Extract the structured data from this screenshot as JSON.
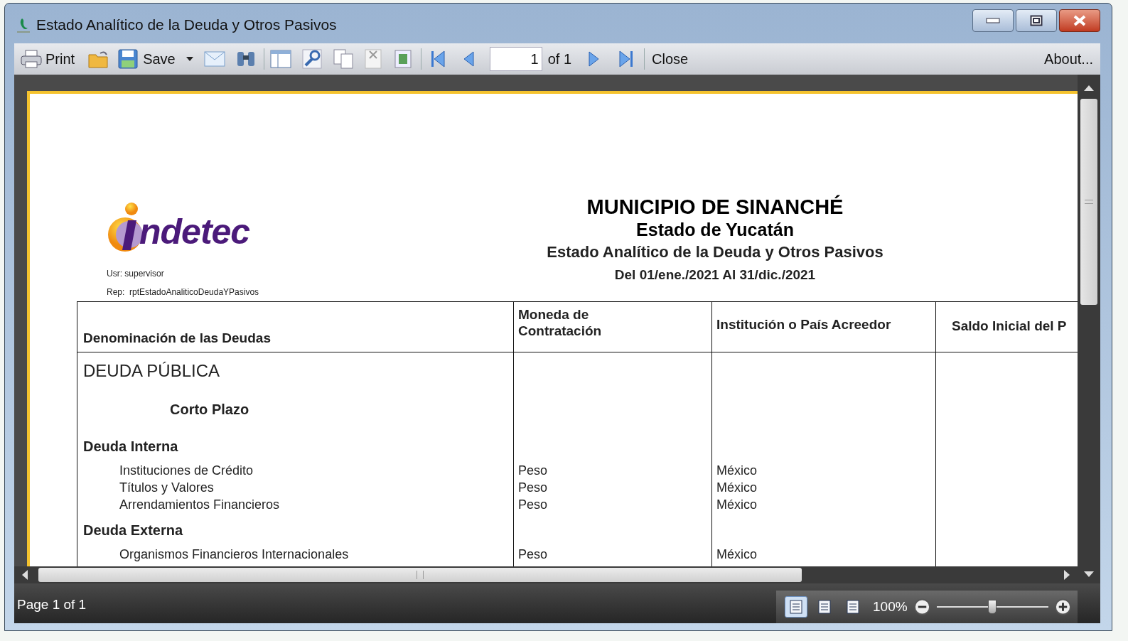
{
  "window": {
    "title": "Estado Analítico de la Deuda y Otros Pasivos"
  },
  "toolbar": {
    "print_label": "Print",
    "save_label": "Save",
    "page_field": {
      "value": "1"
    },
    "page_total": "of 1",
    "close_label": "Close",
    "about_label": "About..."
  },
  "report": {
    "logo_text": "ndetec",
    "user": "Usr: supervisor",
    "rep": "Rep:  rptEstadoAnaliticoDeudaYPasivos",
    "titles": [
      "MUNICIPIO DE SINANCHÉ",
      "Estado de Yucatán",
      "Estado Analítico de la Deuda y Otros Pasivos",
      "Del 01/ene./2021 Al 31/dic./2021"
    ],
    "columns": [
      "Denominación de las Deudas",
      "Moneda de Contratación",
      "Institución o País Acreedor",
      "Saldo Inicial del P"
    ],
    "rows": [
      {
        "kind": "section",
        "name": "DEUDA PÚBLICA"
      },
      {
        "kind": "term",
        "name": "Corto Plazo"
      },
      {
        "kind": "group",
        "name": "Deuda Interna"
      },
      {
        "kind": "item",
        "name": "Instituciones de Crédito",
        "currency": "Peso",
        "creditor": "México"
      },
      {
        "kind": "item",
        "name": "Títulos y Valores",
        "currency": "Peso",
        "creditor": "México"
      },
      {
        "kind": "item",
        "name": "Arrendamientos Financieros",
        "currency": "Peso",
        "creditor": "México"
      },
      {
        "kind": "group",
        "name": "Deuda Externa"
      },
      {
        "kind": "item",
        "name": "Organismos Financieros Internacionales",
        "currency": "Peso",
        "creditor": "México"
      }
    ]
  },
  "status_bar": {
    "page_status": "Page 1 of 1",
    "view_modes": [
      {
        "selected": true
      },
      {
        "selected": false
      },
      {
        "selected": false
      }
    ],
    "zoom": "100%",
    "zoom_slider": {
      "level": 0.5
    }
  }
}
